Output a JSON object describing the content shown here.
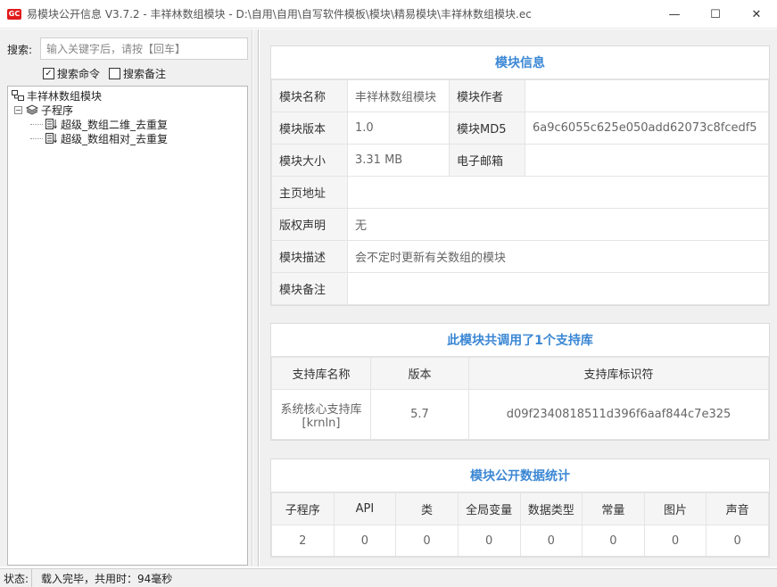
{
  "window": {
    "title": "易模块公开信息 V3.7.2 - 丰祥林数组模块 - D:\\自用\\自用\\自写软件模板\\模块\\精易模块\\丰祥林数组模块.ec",
    "icon_text": "GC",
    "minimize": "—",
    "maximize": "☐",
    "close": "✕"
  },
  "search": {
    "label": "搜索:",
    "placeholder": "输入关键字后，请按【回车】",
    "value": ""
  },
  "options": {
    "search_commands": {
      "label": "搜索命令",
      "checked": true
    },
    "search_notes": {
      "label": "搜索备注",
      "checked": false
    }
  },
  "tree": {
    "root": "丰祥林数组模块",
    "group": "子程序",
    "items": [
      "超级_数组二维_去重复",
      "超级_数组相对_去重复"
    ]
  },
  "module_info": {
    "title": "模块信息",
    "name_label": "模块名称",
    "name_value": "丰祥林数组模块",
    "author_label": "模块作者",
    "author_value": "",
    "version_label": "模块版本",
    "version_value": "1.0",
    "md5_label": "模块MD5",
    "md5_value": "6a9c6055c625e050add62073c8fcedf5",
    "size_label": "模块大小",
    "size_value": "3.31 MB",
    "email_label": "电子邮箱",
    "email_value": "",
    "homepage_label": "主页地址",
    "homepage_value": "",
    "copyright_label": "版权声明",
    "copyright_value": "无",
    "desc_label": "模块描述",
    "desc_value": "会不定时更新有关数组的模块",
    "note_label": "模块备注",
    "note_value": ""
  },
  "support_libs": {
    "title": "此模块共调用了1个支持库",
    "headers": [
      "支持库名称",
      "版本",
      "支持库标识符"
    ],
    "rows": [
      {
        "name_line1": "系统核心支持库",
        "name_line2": "[krnln]",
        "version": "5.7",
        "id": "d09f2340818511d396f6aaf844c7e325"
      }
    ]
  },
  "stats": {
    "title": "模块公开数据统计",
    "headers": [
      "子程序",
      "API",
      "类",
      "全局变量",
      "数据类型",
      "常量",
      "图片",
      "声音"
    ],
    "values": [
      "2",
      "0",
      "0",
      "0",
      "0",
      "0",
      "0",
      "0"
    ]
  },
  "status": {
    "label": "状态:",
    "text": "载入完毕，共用时：94毫秒"
  }
}
